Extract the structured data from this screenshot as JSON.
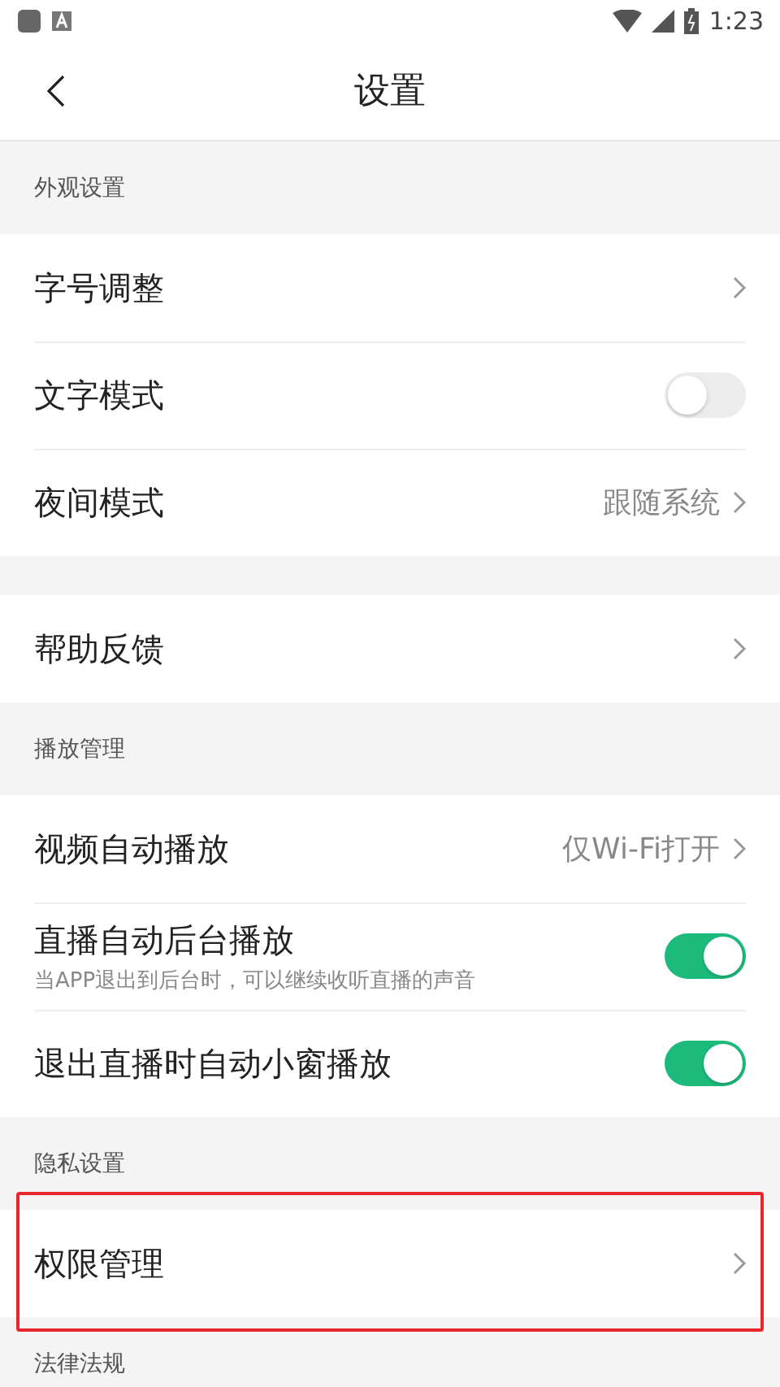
{
  "status_bar": {
    "time": "1:23"
  },
  "header": {
    "title": "设置"
  },
  "sections": [
    {
      "title": "外观设置",
      "items": [
        {
          "kind": "link",
          "label": "字号调整",
          "highlighted": false
        },
        {
          "kind": "toggle",
          "label": "文字模式",
          "on": false
        },
        {
          "kind": "link",
          "label": "夜间模式",
          "value": "跟随系统",
          "highlighted": false
        }
      ]
    },
    {
      "items": [
        {
          "kind": "link",
          "label": "帮助反馈",
          "highlighted": false
        }
      ]
    },
    {
      "title": "播放管理",
      "items": [
        {
          "kind": "link",
          "label": "视频自动播放",
          "value": "仅Wi-Fi打开",
          "highlighted": false
        },
        {
          "kind": "toggle",
          "label": "直播自动后台播放",
          "subtitle": "当APP退出到后台时，可以继续收听直播的声音",
          "on": true
        },
        {
          "kind": "toggle",
          "label": "退出直播时自动小窗播放",
          "on": true
        }
      ]
    },
    {
      "title": "隐私设置",
      "items": [
        {
          "kind": "link",
          "label": "权限管理",
          "highlighted": true
        }
      ]
    },
    {
      "title": "法律法规"
    }
  ]
}
